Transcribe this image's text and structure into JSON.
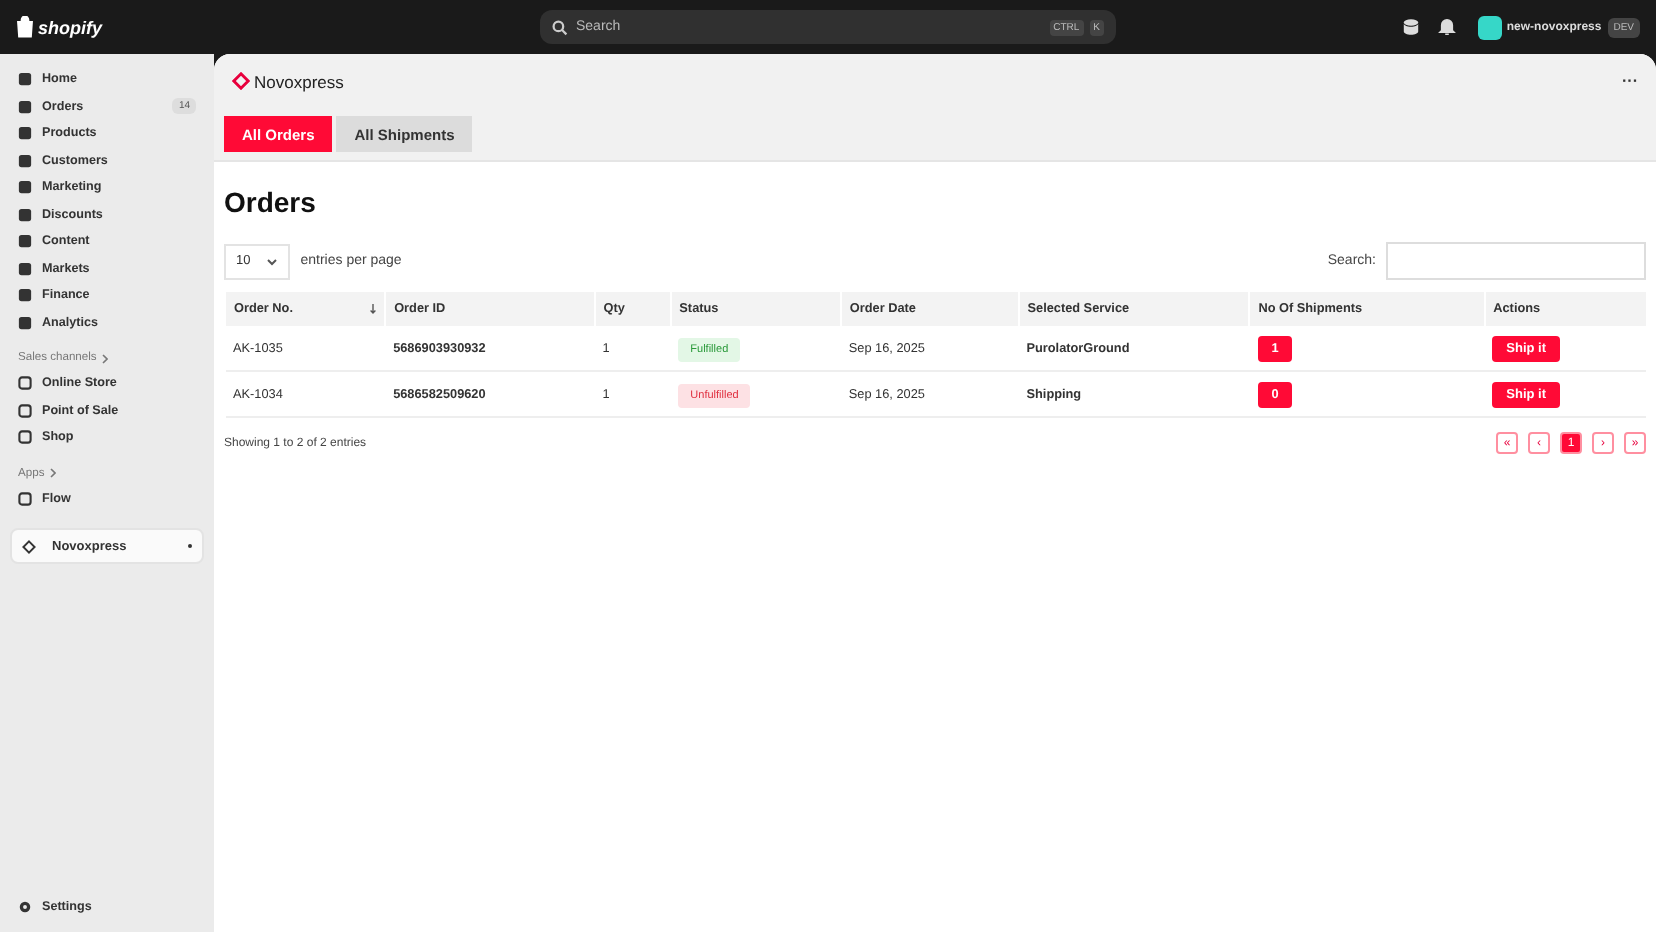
{
  "topbar": {
    "logo": "shopify",
    "search": {
      "placeholder": "Search",
      "shortcut": [
        "CTRL",
        "K"
      ]
    },
    "store": {
      "name": "new-novoxpress",
      "badge": "DEV"
    }
  },
  "sidebar": {
    "items": [
      {
        "label": "Home",
        "selected": false
      },
      {
        "label": "Orders",
        "badge": "14",
        "selected": false
      },
      {
        "label": "Products",
        "selected": false
      },
      {
        "label": "Customers",
        "selected": false
      },
      {
        "label": "Marketing",
        "selected": false
      },
      {
        "label": "Discounts",
        "selected": false
      },
      {
        "label": "Content",
        "selected": false
      },
      {
        "label": "Markets",
        "selected": false
      },
      {
        "label": "Finance",
        "selected": false
      },
      {
        "label": "Analytics",
        "selected": false
      }
    ],
    "sections": [
      {
        "title": "Sales channels",
        "items": [
          {
            "label": "Online Store",
            "selected": false
          },
          {
            "label": "Point of Sale",
            "selected": false
          },
          {
            "label": "Shop",
            "selected": false
          }
        ]
      },
      {
        "title": "Apps",
        "items": [
          {
            "label": "Flow",
            "selected": false
          }
        ]
      }
    ],
    "app": {
      "label": "Novoxpress",
      "selected": true
    },
    "settings": "Settings"
  },
  "app_header": {
    "title": "Novoxpress",
    "menu": "···"
  },
  "tabs": [
    {
      "label": "All Orders",
      "selected": true
    },
    {
      "label": "All Shipments",
      "selected": false
    }
  ],
  "page_title": "Orders",
  "page_size": {
    "value": "10",
    "label": "entries per page"
  },
  "search": {
    "label": "Search:"
  },
  "table": {
    "columns": [
      "Order No.",
      "Order ID",
      "Qty",
      "Status",
      "Order Date",
      "Selected Service",
      "No Of Shipments",
      "Actions"
    ],
    "rows": [
      {
        "order_no": "AK-1035",
        "order_id": "5686903930932",
        "qty": "1",
        "status": "Fulfilled",
        "kind": "fulfilled",
        "date": "Sep 16, 2025",
        "service": "PurolatorGround",
        "shipments": "1",
        "action": "Ship it"
      },
      {
        "order_no": "AK-1034",
        "order_id": "5686582509620",
        "qty": "1",
        "status": "Unfulfilled",
        "kind": "unfulfilled",
        "date": "Sep 16, 2025",
        "service": "Shipping",
        "shipments": "0",
        "action": "Ship it"
      }
    ]
  },
  "footer": {
    "info": "Showing 1 to 2 of 2 entries",
    "pages": [
      {
        "label": "«",
        "selected": false
      },
      {
        "label": "‹",
        "selected": false
      },
      {
        "label": "1",
        "selected": true
      },
      {
        "label": "›",
        "selected": false
      },
      {
        "label": "»",
        "selected": false
      }
    ]
  }
}
